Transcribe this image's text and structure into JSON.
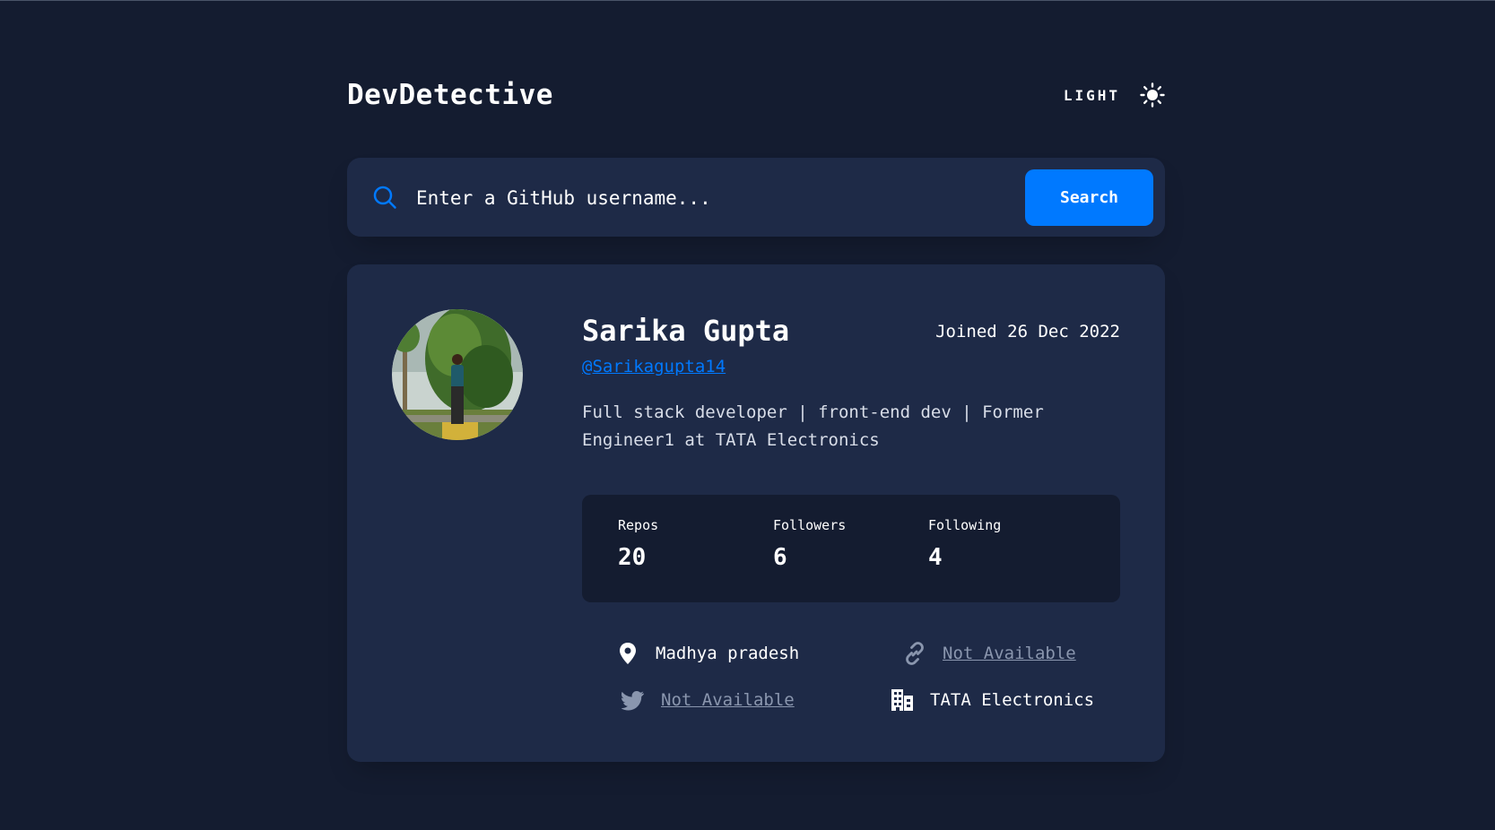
{
  "header": {
    "brand": "DevDetective",
    "theme_label": "LIGHT",
    "theme_icon": "sun-icon"
  },
  "search": {
    "placeholder": "Enter a GitHub username...",
    "button_label": "Search",
    "icon": "search-icon"
  },
  "profile": {
    "name": "Sarika Gupta",
    "joined": "Joined 26 Dec 2022",
    "username": "@Sarikagupta14",
    "bio": "Full stack developer | front-end dev | Former Engineer1 at TATA Electronics",
    "stats": [
      {
        "label": "Repos",
        "value": "20"
      },
      {
        "label": "Followers",
        "value": "6"
      },
      {
        "label": "Following",
        "value": "4"
      }
    ],
    "links": {
      "location": "Madhya pradesh",
      "website": "Not Available",
      "twitter": "Not Available",
      "company": "TATA Electronics"
    }
  },
  "colors": {
    "background": "#141c30",
    "card": "#1e2a47",
    "accent": "#0079ff",
    "muted": "#8a96ae"
  }
}
